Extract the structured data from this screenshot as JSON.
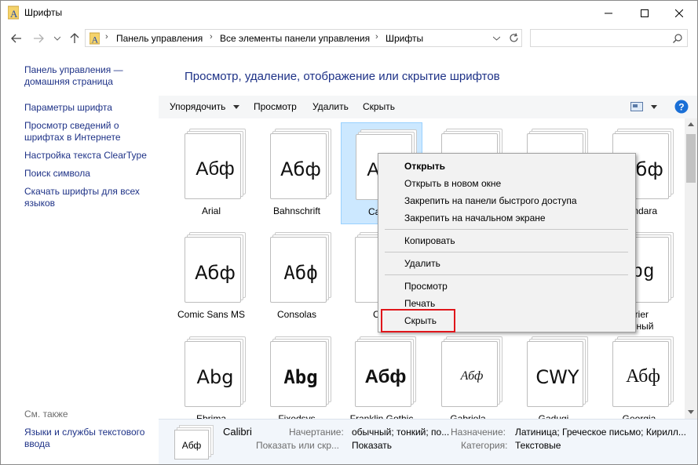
{
  "window": {
    "title": "Шрифты"
  },
  "address": {
    "crumbs": [
      "Панель управления",
      "Все элементы панели управления",
      "Шрифты"
    ],
    "search_placeholder": ""
  },
  "sidebar": {
    "links": [
      {
        "label": "Панель управления — домашняя страница"
      },
      {
        "label": "Параметры шрифта"
      },
      {
        "label": "Просмотр сведений о шрифтах в Интернете"
      },
      {
        "label": "Настройка текста ClearType"
      },
      {
        "label": "Поиск символа"
      },
      {
        "label": "Скачать шрифты для всех языков"
      }
    ],
    "see_also": "См. также",
    "see_also_link": "Языки и службы текстового ввода"
  },
  "main": {
    "title": "Просмотр, удаление, отображение или скрытие шрифтов"
  },
  "toolbar": {
    "organize": "Упорядочить",
    "preview": "Просмотр",
    "delete": "Удалить",
    "hide": "Скрыть"
  },
  "fonts": [
    {
      "name": "Arial",
      "sample": "Абф"
    },
    {
      "name": "Bahnschrift",
      "sample": "Абф"
    },
    {
      "name": "Calibri",
      "sample": "Абф",
      "label_visible": "C"
    },
    {
      "name": "",
      "sample": ""
    },
    {
      "name": "",
      "sample": ""
    },
    {
      "name": "Candara",
      "sample": "Абф",
      "label_visible": "ndara"
    },
    {
      "name": "Comic Sans MS",
      "sample": "Абф"
    },
    {
      "name": "Consolas",
      "sample": "Абф"
    },
    {
      "name": "Con",
      "sample": "А"
    },
    {
      "name": "",
      "sample": ""
    },
    {
      "name": "",
      "sample": ""
    },
    {
      "name": "urier\nычный",
      "sample": "bg"
    },
    {
      "name": "Ebrima",
      "sample": "Abg"
    },
    {
      "name": "Fixedsys",
      "sample": "Abg"
    },
    {
      "name": "Franklin Gothic",
      "sample": "Абф"
    },
    {
      "name": "Gabriola",
      "sample": "Абф"
    },
    {
      "name": "Gadugi",
      "sample": "CWY"
    },
    {
      "name": "Georgia",
      "sample": "Абф"
    }
  ],
  "details": {
    "preview_sample": "Абф",
    "font_name": "Calibri",
    "style_key": "Начертание:",
    "style_val": "обычный; тонкий; по...",
    "show_hide_key": "Показать или скр...",
    "show_hide_val": "Показать",
    "purpose_key": "Назначение:",
    "purpose_val": "Латиница; Греческое письмо; Кирилл...",
    "category_key": "Категория:",
    "category_val": "Текстовые"
  },
  "context_menu": {
    "items": [
      "Открыть",
      "Открыть в новом окне",
      "Закрепить на панели быстрого доступа",
      "Закрепить на начальном экране",
      "Копировать",
      "Удалить",
      "Просмотр",
      "Печать",
      "Скрыть"
    ]
  },
  "colors": {
    "link": "#1e3287",
    "selection": "#cce8ff",
    "highlight_box": "#e0161b",
    "help": "#1a6fd6"
  }
}
